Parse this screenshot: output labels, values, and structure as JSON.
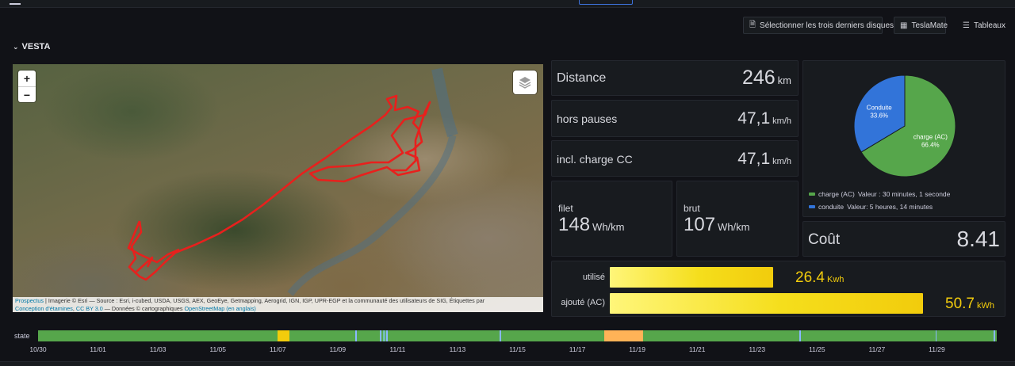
{
  "toolbar": {
    "select_last_three": "Sélectionner les trois derniers disques",
    "teslamate": "TeslaMate",
    "dashboards": "Tableaux"
  },
  "row": {
    "title": "VESTA"
  },
  "map": {
    "zoom_in": "+",
    "zoom_out": "−",
    "attribution": {
      "prospectus": "Prospectus",
      "line1": " | Imagerie © Esri — Source : Esri, i-cubed, USDA, USGS, AEX, GeoEye, Getmapping, Aerogrid, IGN, IGP, UPR-EGP et la communauté des utilisateurs de SIG, Étiquettes par",
      "conception": "Conception d'étamines",
      "ccby": "CC BY 3.0",
      "donnees": " — Données © cartographiques ",
      "osm": "OpenStreetMap (en anglais)",
      "sep": ", "
    },
    "route_color": "#e8201d"
  },
  "stats": {
    "distance": {
      "label": "Distance",
      "value": "246",
      "unit": "km"
    },
    "hors_pauses": {
      "label": "hors pauses",
      "value": "47,1",
      "unit": "km/h"
    },
    "incl_charge": {
      "label": "incl. charge CC",
      "value": "47,1",
      "unit": "km/h"
    },
    "filet": {
      "label": "filet",
      "value": "148",
      "unit": "Wh/km"
    },
    "brut": {
      "label": "brut",
      "value": "107",
      "unit": "Wh/km"
    },
    "cout": {
      "label": "Coût",
      "value": "8.41"
    }
  },
  "pie": {
    "slices": [
      {
        "name": "charge (AC)",
        "pct_label": "66.4%",
        "fraction": 0.664,
        "color": "#56a64b"
      },
      {
        "name": "Conduite",
        "pct_label": "33.6%",
        "fraction": 0.336,
        "color": "#3274d9"
      }
    ],
    "legend": [
      {
        "name": "charge (AC)",
        "text": "Valeur : 30 minutes, 1 seconde",
        "color": "#56a64b"
      },
      {
        "name": "conduite",
        "text": "Valeur: 5 heures, 14 minutes",
        "color": "#3274d9"
      }
    ]
  },
  "energy": {
    "max": 50.7,
    "bars": [
      {
        "label": "utilisé",
        "value": 26.4,
        "value_text": "26.4",
        "unit": "Kwh"
      },
      {
        "label": "ajouté (AC)",
        "value": 50.7,
        "value_text": "50.7",
        "unit": "kWh"
      }
    ],
    "color": "#f2cc0c"
  },
  "state": {
    "label": "state",
    "start": "10/30",
    "end": "12/01",
    "ticks": [
      "10/30",
      "11/01",
      "11/03",
      "11/05",
      "11/07",
      "11/09",
      "11/11",
      "11/13",
      "11/15",
      "11/17",
      "11/19",
      "11/21",
      "11/23",
      "11/25",
      "11/27",
      "11/29"
    ],
    "base_color": "#56a64b",
    "segments": [
      {
        "from": 8.0,
        "to": 8.4,
        "color": "#f2cc0c"
      },
      {
        "from": 10.6,
        "to": 10.65,
        "color": "#8ab8ff"
      },
      {
        "from": 11.4,
        "to": 11.45,
        "color": "#8ab8ff"
      },
      {
        "from": 11.52,
        "to": 11.6,
        "color": "#73bfb8"
      },
      {
        "from": 11.62,
        "to": 11.68,
        "color": "#8ab8ff"
      },
      {
        "from": 15.4,
        "to": 15.45,
        "color": "#8ab8ff"
      },
      {
        "from": 18.9,
        "to": 20.2,
        "color": "#ffb357"
      },
      {
        "from": 25.4,
        "to": 25.45,
        "color": "#8ab8ff"
      },
      {
        "from": 29.95,
        "to": 30.0,
        "color": "#8ab8ff"
      },
      {
        "from": 31.9,
        "to": 31.95,
        "color": "#8ab8ff"
      }
    ]
  }
}
